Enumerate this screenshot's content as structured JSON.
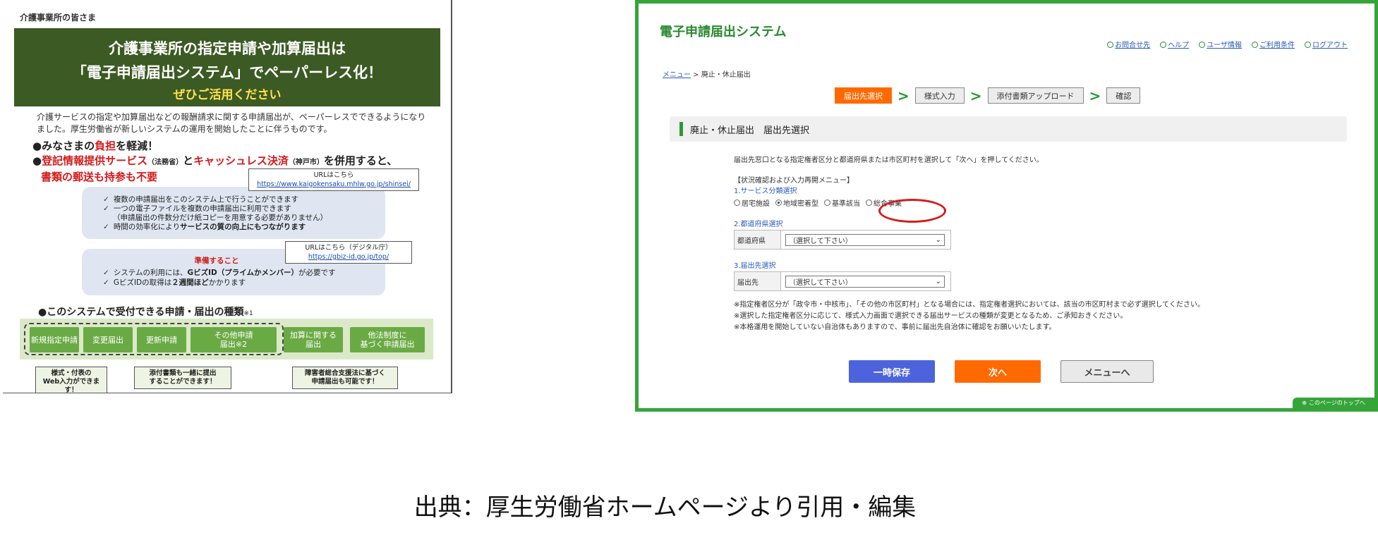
{
  "flyer": {
    "to": "介護事業所の皆さま",
    "banner": {
      "line1": "介護事業所の指定申請や加算届出は",
      "line2": "「電子申請届出システム」でペーパーレス化！",
      "line3": "ぜひご活用ください"
    },
    "intro": "介護サービスの指定や加算届出などの報酬請求に関する申請届出が、ペーパーレスでできるようになりました。厚生労働省が新しいシステムの運用を開始したことに伴うものです。",
    "bullet1": {
      "pre": "●みなさまの",
      "em": "負担",
      "post": "を軽減！"
    },
    "bullet2": {
      "pre": "●",
      "em1": "登記情報提供サービス",
      "sm1": "（法務省）",
      "mid": "と",
      "em2": "キャッシュレス決済",
      "sm2": "（神戸市）",
      "post": "を併用すると、",
      "line2": "書類の郵送も持参も不要"
    },
    "box1": {
      "items": [
        "複数の申請届出をこのシステム上で行うことができます",
        "一つの電子ファイルを複数の申請届出に利用できます",
        "（申請届出の件数分だけ紙コピーを用意する必要がありません）",
        "時間の効率化により"
      ],
      "item4_em": "サービスの質の向上にもつながります"
    },
    "callout1": {
      "title": "URLはこちら",
      "url": "https://www.kaigokensaku.mhlw.go.jp/shinsei/"
    },
    "box2": {
      "heading": "準備すること",
      "item1_pre": "システムの利用には、",
      "item1_em": "GビズID（プライムかメンバー）",
      "item1_post": "が必要です",
      "item2_pre": "GビズIDの取得は",
      "item2_em": "２週間ほど",
      "item2_post": "かかります"
    },
    "callout2": {
      "title": "URLはこちら（デジタル庁）",
      "url": "https://gbiz-id.go.jp/top/"
    },
    "kinds_title": "●このシステムで受付できる申請・届出の種類",
    "kinds_sup": "※1",
    "kinds": [
      "新規指定申請",
      "変更届出",
      "更新申請",
      "その他申請\n届出※2",
      "加算に関する\n届出",
      "他法制度に\n基づく申請届出"
    ],
    "notes": [
      "様式・付表の\nWeb入力ができます！",
      "添付書類も一緒に提出\nすることができます！",
      "障害者総合支援法に基づく\n申請届出も可能です！"
    ]
  },
  "system": {
    "title": "電子申請届出システム",
    "links": [
      "お問合せ先",
      "ヘルプ",
      "ユーザ情報",
      "ご利用条件",
      "ログアウト"
    ],
    "crumb_link": "メニュー",
    "crumb_rest": " > 廃止・休止届出",
    "steps": [
      "届出先選択",
      "様式入力",
      "添付書類アップロード",
      "確認"
    ],
    "section_title": "廃止・休止届出　届出先選択",
    "instruction": "届出先窓口となる指定権者区分と都道府県または市区町村を選択して「次へ」を押してください。",
    "status_link": "【状況確認および入力再開メニュー】",
    "group1_label": "1.サービス分類選択",
    "radios": [
      "居宅施設",
      "地域密着型",
      "基準該当",
      "総合事業"
    ],
    "radio_selected": 1,
    "group2_label": "2.都道府県選択",
    "row2_label": "都道府県",
    "row2_value": "（選択して下さい）",
    "group3_label": "3.届出先選択",
    "row3_label": "届出先",
    "row3_value": "（選択して下さい）",
    "notes": [
      "※指定権者区分が「政令市・中核市」、「その他の市区町村」となる場合には、指定権者選択においては、該当の市区町村まで必ず選択してください。",
      "※選択した指定権者区分に応じて、様式入力画面で選択できる届出サービスの種類が変更となるため、ご承知おきください。",
      "※本格運用を開始していない自治体もありますので、事前に届出先自治体に確認をお願いいたします。"
    ],
    "buttons": {
      "save": "一時保存",
      "next": "次へ",
      "menu": "メニューへ"
    },
    "to_top": "このページのトップへ"
  },
  "caption": "出典：厚生労働省ホームページより引用・編集",
  "colors": {
    "banner": "#3c5a23",
    "accent_orange": "#ff6a00",
    "system_green": "#35a53a",
    "save_blue": "#4d63dc"
  }
}
